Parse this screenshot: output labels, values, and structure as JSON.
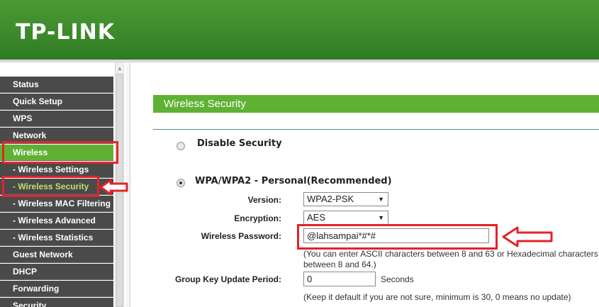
{
  "header": {
    "logo": "TP-LINK"
  },
  "sidebar": {
    "items": [
      {
        "label": "Status"
      },
      {
        "label": "Quick Setup"
      },
      {
        "label": "WPS"
      },
      {
        "label": "Network"
      },
      {
        "label": "Wireless"
      },
      {
        "label": "- Wireless Settings"
      },
      {
        "label": "- Wireless Security"
      },
      {
        "label": "- Wireless MAC Filtering"
      },
      {
        "label": "- Wireless Advanced"
      },
      {
        "label": "- Wireless Statistics"
      },
      {
        "label": "Guest Network"
      },
      {
        "label": "DHCP"
      },
      {
        "label": "Forwarding"
      },
      {
        "label": "Security"
      }
    ]
  },
  "main": {
    "section_title": "Wireless Security",
    "disable_security_label": "Disable Security",
    "wpa_label": "WPA/WPA2 - Personal(Recommended)",
    "version": {
      "label": "Version:",
      "value": "WPA2-PSK"
    },
    "encryption": {
      "label": "Encryption:",
      "value": "AES"
    },
    "password": {
      "label": "Wireless Password:",
      "value": "@lahsampai*#*#",
      "hint_line1": "(You can enter ASCII characters between 8 and 63 or Hexadecimal characters",
      "hint_line2": "between 8 and 64.)"
    },
    "group_key": {
      "label": "Group Key Update Period:",
      "value": "0",
      "unit": "Seconds",
      "hint": "(Keep it default if you are not sure, minimum is 30, 0 means no update)"
    }
  },
  "colors": {
    "brand_green": "#4a9a36",
    "menu_active": "#5fb134",
    "menu_bg": "#4a4a4a",
    "annotation_red": "#e2232a"
  }
}
